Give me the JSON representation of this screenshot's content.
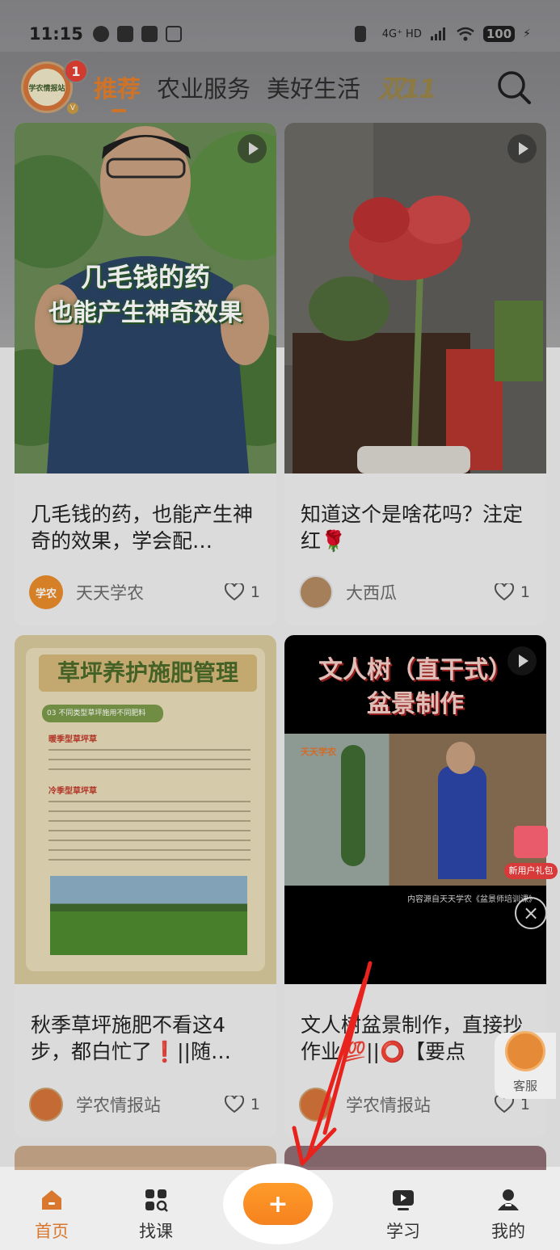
{
  "status_bar": {
    "time": "11:15",
    "network": "4G⁺ HD",
    "battery": "100"
  },
  "header": {
    "avatar_text": "学农情报站",
    "badge_count": "1",
    "tabs": [
      "推荐",
      "农业服务",
      "美好生活"
    ],
    "promo": "双11",
    "search_icon": "search-icon"
  },
  "cards": [
    {
      "overlay_line1": "几毛钱的药",
      "overlay_line2": "也能产生神奇效果",
      "title": "几毛钱的药，也能产生神奇的效果，学会配…",
      "author": "天天学农",
      "author_avatar_text": "学农",
      "likes": "1",
      "is_video": true
    },
    {
      "title": "知道这个是啥花吗？注定红🌹",
      "author": "大西瓜",
      "likes": "1",
      "is_video": true
    },
    {
      "overlay_line1": "草坪养护施肥管理",
      "overlay_sub": "03 不同类型草坪施用不同肥料",
      "cool_season": "暖季型草坪草",
      "warm_season": "冷季型草坪草",
      "title": "秋季草坪施肥不看这4步，都白忙了❗️||随…",
      "author": "学农情报站",
      "likes": "1",
      "is_video": false
    },
    {
      "overlay_line1": "文人树（直干式）",
      "overlay_line2": "盆景制作",
      "brand": "天天学农",
      "source_note": "内容源自天天学农《盆景师培训课》",
      "title": "文人树盆景制作，直接抄作业💯||⭕【要点",
      "author": "学农情报站",
      "likes": "1",
      "is_video": true
    }
  ],
  "floating": {
    "new_user_gift": "新用户礼包",
    "customer_service": "客服"
  },
  "tabbar": {
    "items": [
      "首页",
      "找课",
      "学习",
      "我的"
    ],
    "plus": "+"
  },
  "colors": {
    "accent": "#e07d2b",
    "plus_button": "#f5821f",
    "annotation_arrow": "#e8231e"
  }
}
